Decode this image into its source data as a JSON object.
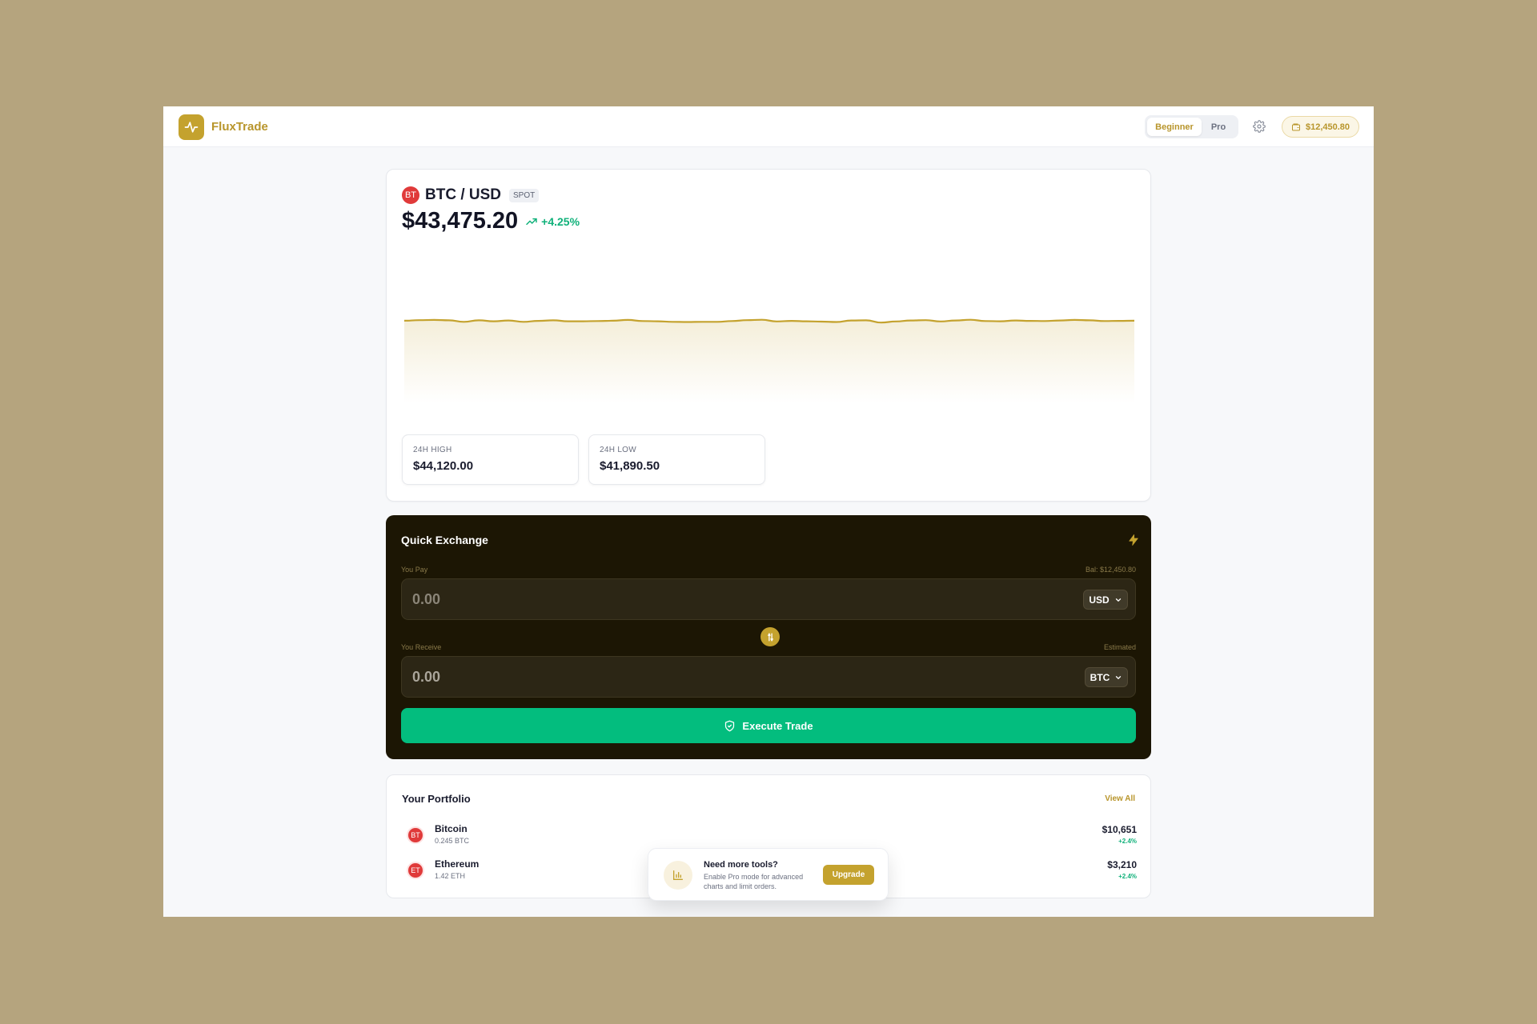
{
  "header": {
    "brand": "FluxTrade",
    "modes": [
      "Beginner",
      "Pro"
    ],
    "active_mode": "Beginner",
    "balance": "$12,450.80"
  },
  "ticker": {
    "badge": "BT",
    "pair": "BTC / USD",
    "tag": "SPOT",
    "price": "$43,475.20",
    "change": "+4.25%",
    "high_label": "24H HIGH",
    "high_value": "$44,120.00",
    "low_label": "24H LOW",
    "low_value": "$41,890.50"
  },
  "chart_data": {
    "type": "area",
    "title": "",
    "xlabel": "",
    "ylabel": "",
    "values": [
      44.2,
      44.5,
      44.6,
      44.4,
      43.6,
      44.4,
      43.9,
      44.3,
      43.6,
      44.1,
      44.4,
      43.9,
      43.9,
      44.0,
      44.2,
      44.6,
      44.0,
      43.9,
      43.6,
      43.5,
      43.6,
      43.6,
      44.0,
      44.5,
      44.7,
      43.8,
      44.1,
      43.9,
      43.7,
      43.5,
      44.3,
      44.4,
      43.2,
      43.8,
      44.3,
      44.5,
      43.8,
      44.3,
      44.7,
      44.0,
      43.9,
      44.3,
      44.1,
      44.0,
      44.3,
      44.6,
      44.4,
      44.0,
      44.1,
      44.2
    ],
    "ylim": [
      0,
      60
    ],
    "line_color": "#c4a22e",
    "grid": false
  },
  "exchange": {
    "title": "Quick Exchange",
    "pay_label": "You Pay",
    "balance_note": "Bal: $12,450.80",
    "pay_value": "0.00",
    "pay_currency": "USD",
    "receive_label": "You Receive",
    "estimated_note": "Estimated",
    "receive_value": "0.00",
    "receive_currency": "BTC",
    "execute_label": "Execute Trade"
  },
  "portfolio": {
    "title": "Your Portfolio",
    "view_all": "View All",
    "items": [
      {
        "badge": "BT",
        "name": "Bitcoin",
        "amount": "0.245 BTC",
        "value": "$10,651",
        "change": "+2.4%"
      },
      {
        "badge": "ET",
        "name": "Ethereum",
        "amount": "1.42 ETH",
        "value": "$3,210",
        "change": "+2.4%"
      }
    ]
  },
  "upgrade": {
    "title": "Need more tools?",
    "description": "Enable Pro mode for advanced charts and limit orders.",
    "button": "Upgrade"
  },
  "colors": {
    "accent": "#c4a22e",
    "positive": "#10b17a",
    "exchange_bg": "#1c1604",
    "execute_button": "#03bd7e",
    "coin_badge": "#e03a3a"
  }
}
